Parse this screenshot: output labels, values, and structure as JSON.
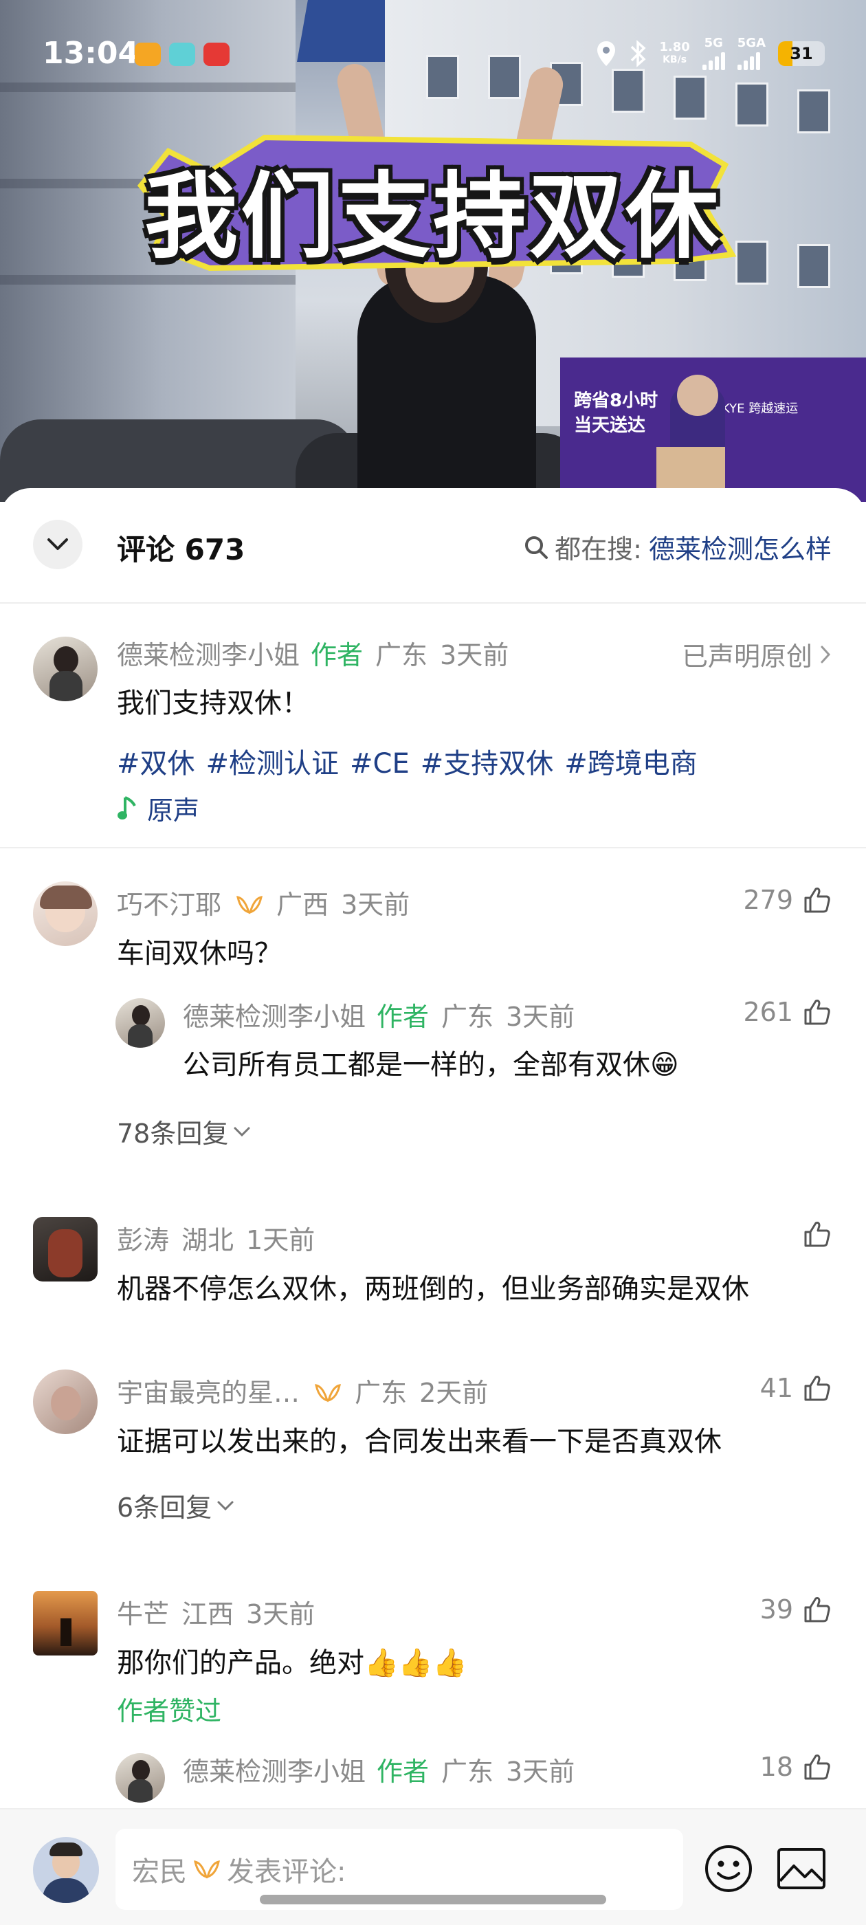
{
  "status_bar": {
    "time": "13:04",
    "net_speed_value": "1.80",
    "net_speed_unit": "KB/s",
    "sim1_label": "5G",
    "sim2_label": "5GA",
    "battery_level": "31",
    "battery_fraction": 0.31
  },
  "video": {
    "headline": "我们支持双休",
    "truck_line1": "跨省8小时",
    "truck_line2": "当天送达",
    "truck_brand": "KYE 跨越速运"
  },
  "comments_header": {
    "title": "评论 673",
    "search_prefix": "都在搜:",
    "search_term": "德莱检测怎么样"
  },
  "post": {
    "author": "德莱检测李小姐",
    "author_tag": "作者",
    "location": "广东",
    "time": "3天前",
    "declared_original": "已声明原创",
    "text": "我们支持双休！",
    "hashtags": [
      "#双休",
      "#检测认证",
      "#CE",
      "#支持双休",
      "#跨境电商"
    ],
    "sound": "原声"
  },
  "comments": [
    {
      "user": "巧不汀耶",
      "location": "广西",
      "time": "3天前",
      "likes": "279",
      "text": "车间双休吗？",
      "reply": {
        "user": "德莱检测李小姐",
        "tag": "作者",
        "location": "广东",
        "time": "3天前",
        "likes": "261",
        "text": "公司所有员工都是一样的，全部有双休😁"
      },
      "more_replies": "78条回复"
    },
    {
      "user": "彭涛",
      "location": "湖北",
      "time": "1天前",
      "likes": "",
      "text": "机器不停怎么双休，两班倒的，但业务部确实是双休"
    },
    {
      "user": "宇宙最亮的星…",
      "location": "广东",
      "time": "2天前",
      "likes": "41",
      "text": "证据可以发出来的，合同发出来看一下是否真双休",
      "more_replies": "6条回复"
    },
    {
      "user": "牛芒",
      "location": "江西",
      "time": "3天前",
      "likes": "39",
      "text": "那你们的产品。绝对👍👍👍",
      "author_liked": "作者赞过",
      "reply": {
        "user": "德莱检测李小姐",
        "tag": "作者",
        "location": "广东",
        "time": "3天前",
        "likes": "18"
      }
    }
  ],
  "bottom_bar": {
    "my_name": "宏民",
    "input_placeholder": "发表评论:"
  },
  "colors": {
    "accent_green": "#2fb463",
    "link_blue": "#1f3f86",
    "meta_gray": "#8a8a8a"
  },
  "icons": [
    "chevron-down-icon",
    "search-icon",
    "chevron-right-icon",
    "music-note-icon",
    "thumbs-up-icon",
    "wings-badge-icon",
    "emoji-icon",
    "image-icon"
  ]
}
